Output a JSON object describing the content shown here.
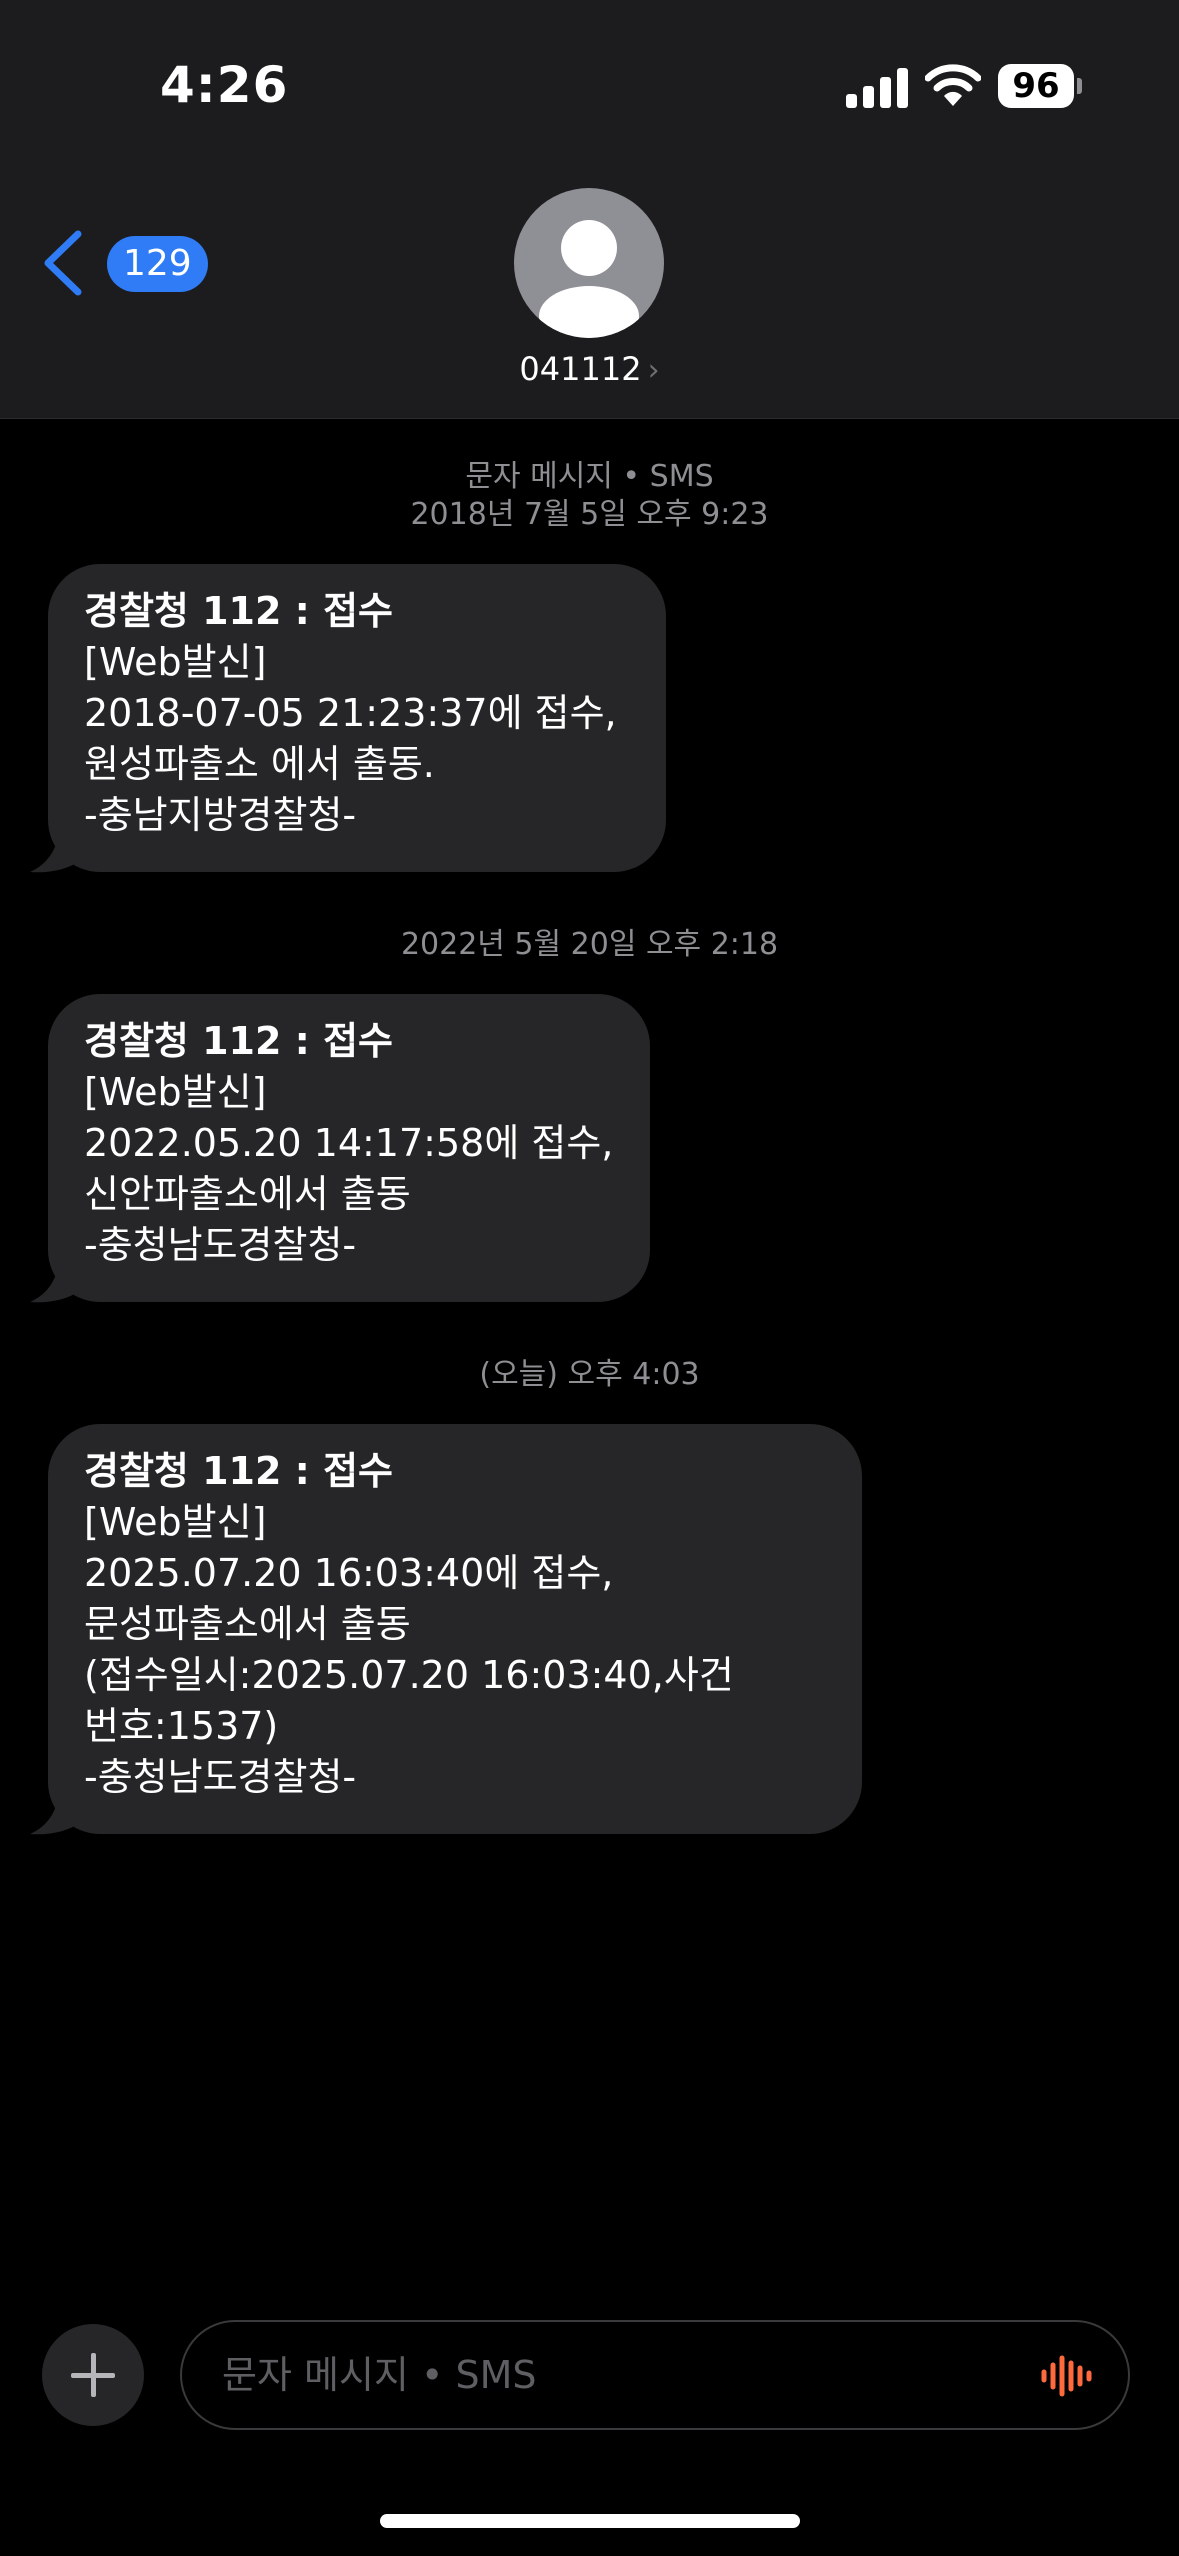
{
  "status_bar": {
    "time": "4:26",
    "battery": "96"
  },
  "header": {
    "back_badge": "129",
    "contact_name": "041112",
    "contact_chevron": "›"
  },
  "conversation": {
    "timestamps": [
      {
        "line1": "문자 메시지 • SMS",
        "line2": "2018년 7월 5일 오후 9:23"
      },
      {
        "line1": "2022년 5월 20일 오후 2:18"
      },
      {
        "line1": "(오늘) 오후 4:03"
      }
    ],
    "messages": [
      {
        "lines": [
          "경찰청 112 : 접수",
          "[Web발신]",
          "2018-07-05 21:23:37에 접수,",
          "원성파출소 에서 출동.",
          "-충남지방경찰청-"
        ]
      },
      {
        "lines": [
          "경찰청 112 : 접수",
          "[Web발신]",
          "2022.05.20 14:17:58에 접수,",
          "신안파출소에서 출동",
          "-충청남도경찰청-"
        ]
      },
      {
        "lines": [
          "경찰청 112 : 접수",
          "[Web발신]",
          "2025.07.20 16:03:40에 접수,",
          "문성파출소에서 출동",
          "(접수일시:2025.07.20 16:03:40,사건",
          "번호:1537)",
          "-충청남도경찰청-"
        ]
      }
    ]
  },
  "input": {
    "placeholder": "문자 메시지 • SMS"
  },
  "icons": {
    "back": "chevron-left-icon",
    "avatar": "person-icon",
    "add": "plus-icon",
    "voice": "waveform-icon",
    "signal": "cellular-signal-icon",
    "wifi": "wifi-icon",
    "battery": "battery-icon"
  },
  "colors": {
    "accent": "#2f7cf6",
    "bubble": "#262628",
    "header": "#1c1c1e",
    "voice": "#ff6a3d"
  }
}
